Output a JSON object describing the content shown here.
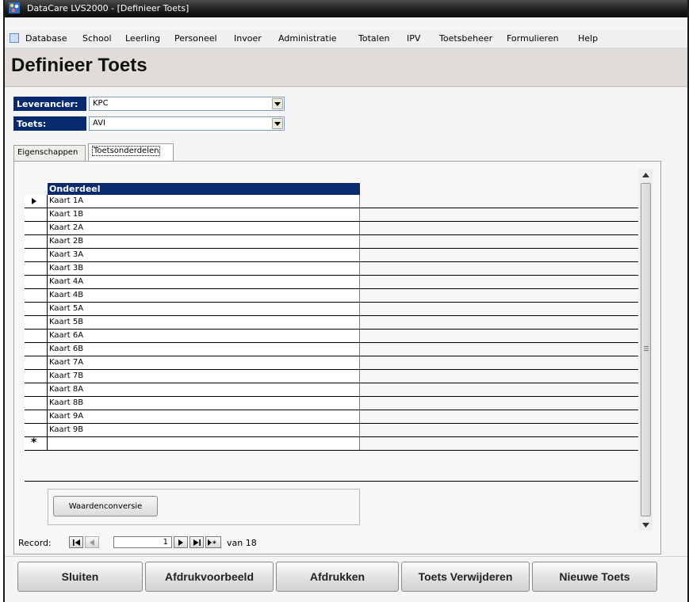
{
  "window": {
    "title": "DataCare LVS2000 - [Definieer Toets]"
  },
  "menu": [
    "Database",
    "School",
    "Leerling",
    "Personeel",
    "Invoer",
    "Administratie",
    "Totalen",
    "IPV",
    "Toetsbeheer",
    "Formulieren",
    "Help"
  ],
  "page_title": "Definieer Toets",
  "fields": {
    "leverancier": {
      "label": "Leverancier:",
      "value": "KPC"
    },
    "toets": {
      "label": "Toets:",
      "value": "AVI"
    }
  },
  "tabs": [
    {
      "label": "Eigenschappen",
      "active": false
    },
    {
      "label": "Toetsonderdelen",
      "active": true
    }
  ],
  "grid": {
    "column": "Onderdeel",
    "rows": [
      "Kaart 1A",
      "Kaart 1B",
      "Kaart 2A",
      "Kaart 2B",
      "Kaart 3A",
      "Kaart 3B",
      "Kaart 4A",
      "Kaart 4B",
      "Kaart 5A",
      "Kaart 5B",
      "Kaart 6A",
      "Kaart 6B",
      "Kaart 7A",
      "Kaart 7B",
      "Kaart 8A",
      "Kaart 8B",
      "Kaart 9A",
      "Kaart 9B"
    ],
    "new_row_marker": "*"
  },
  "subform_button": "Waardenconversie",
  "record_nav": {
    "label": "Record:",
    "current": "1",
    "of_label": "van",
    "total": "18"
  },
  "bottom_buttons": {
    "close": "Sluiten",
    "preview": "Afdrukvoorbeeld",
    "print": "Afdrukken",
    "delete": "Toets Verwijderen",
    "new": "Nieuwe Toets"
  }
}
